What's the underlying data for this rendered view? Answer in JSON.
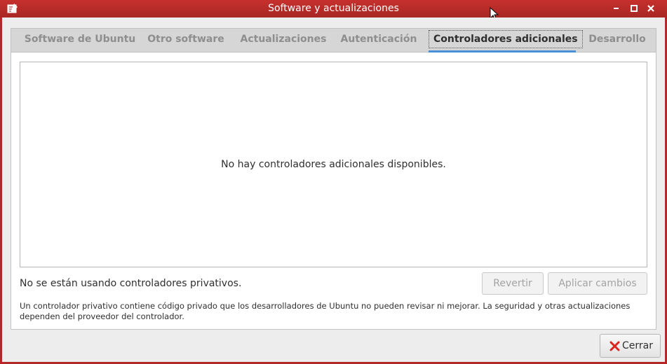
{
  "window": {
    "title": "Software y actualizaciones"
  },
  "tabs": [
    {
      "label": "Software de Ubuntu",
      "active": false
    },
    {
      "label": "Otro software",
      "active": false
    },
    {
      "label": "Actualizaciones",
      "active": false
    },
    {
      "label": "Autenticación",
      "active": false
    },
    {
      "label": "Controladores adicionales",
      "active": true
    },
    {
      "label": "Desarrollo",
      "active": false
    }
  ],
  "drivers": {
    "empty_message": "No hay controladores adicionales disponibles.",
    "status": "No se están usando controladores privativos.",
    "revert_label": "Revertir",
    "apply_label": "Aplicar cambios",
    "note": "Un controlador privativo contiene código privado que los desarrolladores de Ubuntu no pueden revisar ni mejorar. La seguridad y otras actualizaciones dependen del proveedor del controlador."
  },
  "footer": {
    "close_label": "Cerrar"
  },
  "icons": {
    "app": "software-properties-icon",
    "minimize": "minimize-icon",
    "maximize": "maximize-icon",
    "close": "close-icon",
    "close_button": "close-x-icon"
  },
  "colors": {
    "titlebar": "#b12a27",
    "accent": "#4a90d9",
    "close_x": "#d9251d"
  }
}
